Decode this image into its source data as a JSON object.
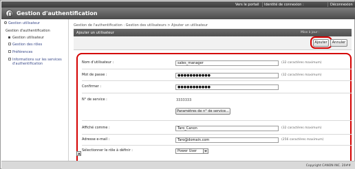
{
  "topbar": {
    "portal_link": "Vers le portail",
    "login_id": "Identité de connexion :",
    "logout": "Déconnexion"
  },
  "app": {
    "title": "Gestion d'authentification",
    "icon": "lock-icon"
  },
  "sidebar": {
    "items": [
      {
        "label": "Gestion utilisateur",
        "icon": "circle-bullet-icon"
      },
      {
        "label": "Gestion d'authentification",
        "icon": "none"
      },
      {
        "label": "Gestion utilisateur",
        "icon": "square-bullet-icon"
      },
      {
        "label": "Gestion des rôles",
        "icon": "box-bullet-icon"
      },
      {
        "label": "Préférences",
        "icon": "box-bullet-icon"
      },
      {
        "label": "Informations sur les services",
        "icon": "box-bullet-icon"
      },
      {
        "label": "d'authentification",
        "icon": "none"
      }
    ]
  },
  "main": {
    "breadcrumb": "Gestion de l'authentification : Gestion des utilisateurs > Ajouter un utilisateur",
    "header_title": "Ajouter un utilisateur",
    "header_meta": "Mise à jour :",
    "buttons": {
      "add": "Ajouter",
      "cancel": "Annuler"
    }
  },
  "form": {
    "username": {
      "label": "Nom d'utilisateur :",
      "value": "sales_manager",
      "hint": "(32 caractères maximum)"
    },
    "password": {
      "label": "Mot de passe :",
      "value": "●●●●●●●●●●●",
      "hint": "(32 caractères maximum)"
    },
    "confirm": {
      "label": "Confirmer :",
      "value": "●●●●●●●●●●●"
    },
    "service_no": {
      "label": "N° de service :",
      "value": "3333333",
      "button": "Paramètres de n° de service..."
    },
    "display_name": {
      "label": "Affiché comme :",
      "value": "Taro_Canon",
      "hint": "(32 caractères maximum)"
    },
    "email": {
      "label": "Adresse e-mail :",
      "value": "Taro@domain.com",
      "hint": "(256 caractères maximum)"
    },
    "role": {
      "label": "Sélectionner le rôle à définir :",
      "value": "Power User"
    }
  },
  "footer": {
    "copyright": "Copyright CANON INC. 20##"
  },
  "colors": {
    "highlight": "#d40000",
    "header_dark": "#4a4a4a"
  }
}
